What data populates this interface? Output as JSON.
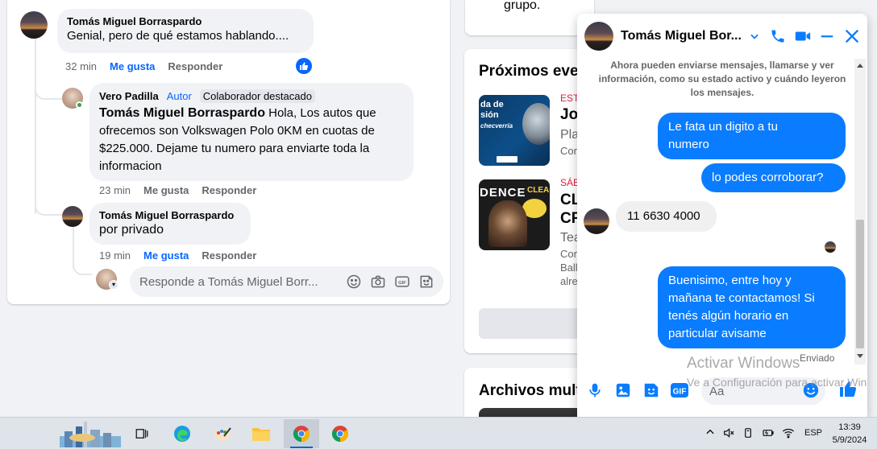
{
  "comments": {
    "c1": {
      "author": "Tomás Miguel Borraspardo",
      "text": "Genial, pero de qué estamos hablando....",
      "time": "32 min",
      "like": "Me gusta",
      "reply": "Responder"
    },
    "c2": {
      "author": "Vero Padilla",
      "badge_author": "Autor",
      "badge_top": "Colaborador destacado",
      "mention": "Tomás Miguel Borraspardo",
      "text_l1": " Hola, Los autos que",
      "text_l2": "ofrecemos son Volkswagen Polo 0KM en cuotas de",
      "text_l3": "$225.000. Dejame tu numero para enviarte toda la",
      "text_l4": "informacion",
      "time": "23 min",
      "like": "Me gusta",
      "reply": "Responder"
    },
    "c3": {
      "author": "Tomás Miguel Borraspardo",
      "text": "por privado",
      "time": "19 min",
      "like": "Me gusta",
      "reply": "Responder"
    },
    "reply_placeholder": "Responde a Tomás Miguel Borr..."
  },
  "right_column": {
    "group_fragment": "grupo.",
    "events_title": "Próximos even",
    "event1": {
      "thumb_l1": "da de",
      "thumb_l2": "sión",
      "thumb_l3": "checverría",
      "date": "EST",
      "title": "Jor",
      "line1": "Pla",
      "line2": "Cor"
    },
    "event2": {
      "thumb_l1": "DENCE",
      "thumb_l2": "CLEA",
      "date": "SÁB",
      "title_l1": "CL",
      "title_l2": "CR",
      "line1": "Tea",
      "line2": "Cor",
      "line3": "Ball",
      "line4": "alre"
    },
    "files_title": "Archivos multi"
  },
  "chat": {
    "name": "Tomás Miguel Bor...",
    "info": "Ahora pueden enviarse mensajes, llamarse y ver información, como su estado activo y cuándo leyeron los mensajes.",
    "messages": {
      "m1_l1": "Le fata un digito a tu",
      "m1_l2": "numero",
      "m2": "lo podes corroborar?",
      "m3": "11 6630 4000",
      "m4_l1": "Buenisimo, entre hoy y",
      "m4_l2": "mañana te contactamos! Si",
      "m4_l3": "tenés algún horario en",
      "m4_l4": "particular avisame"
    },
    "sent_status": "Enviado",
    "composer_placeholder": "Aa",
    "accent": "#0a7cff"
  },
  "watermark": {
    "title": "Activar Windows",
    "subtitle": "Ve a Configuración para activar Win"
  },
  "taskbar": {
    "lang": "ESP",
    "time": "13:39",
    "date": "5/9/2024"
  }
}
